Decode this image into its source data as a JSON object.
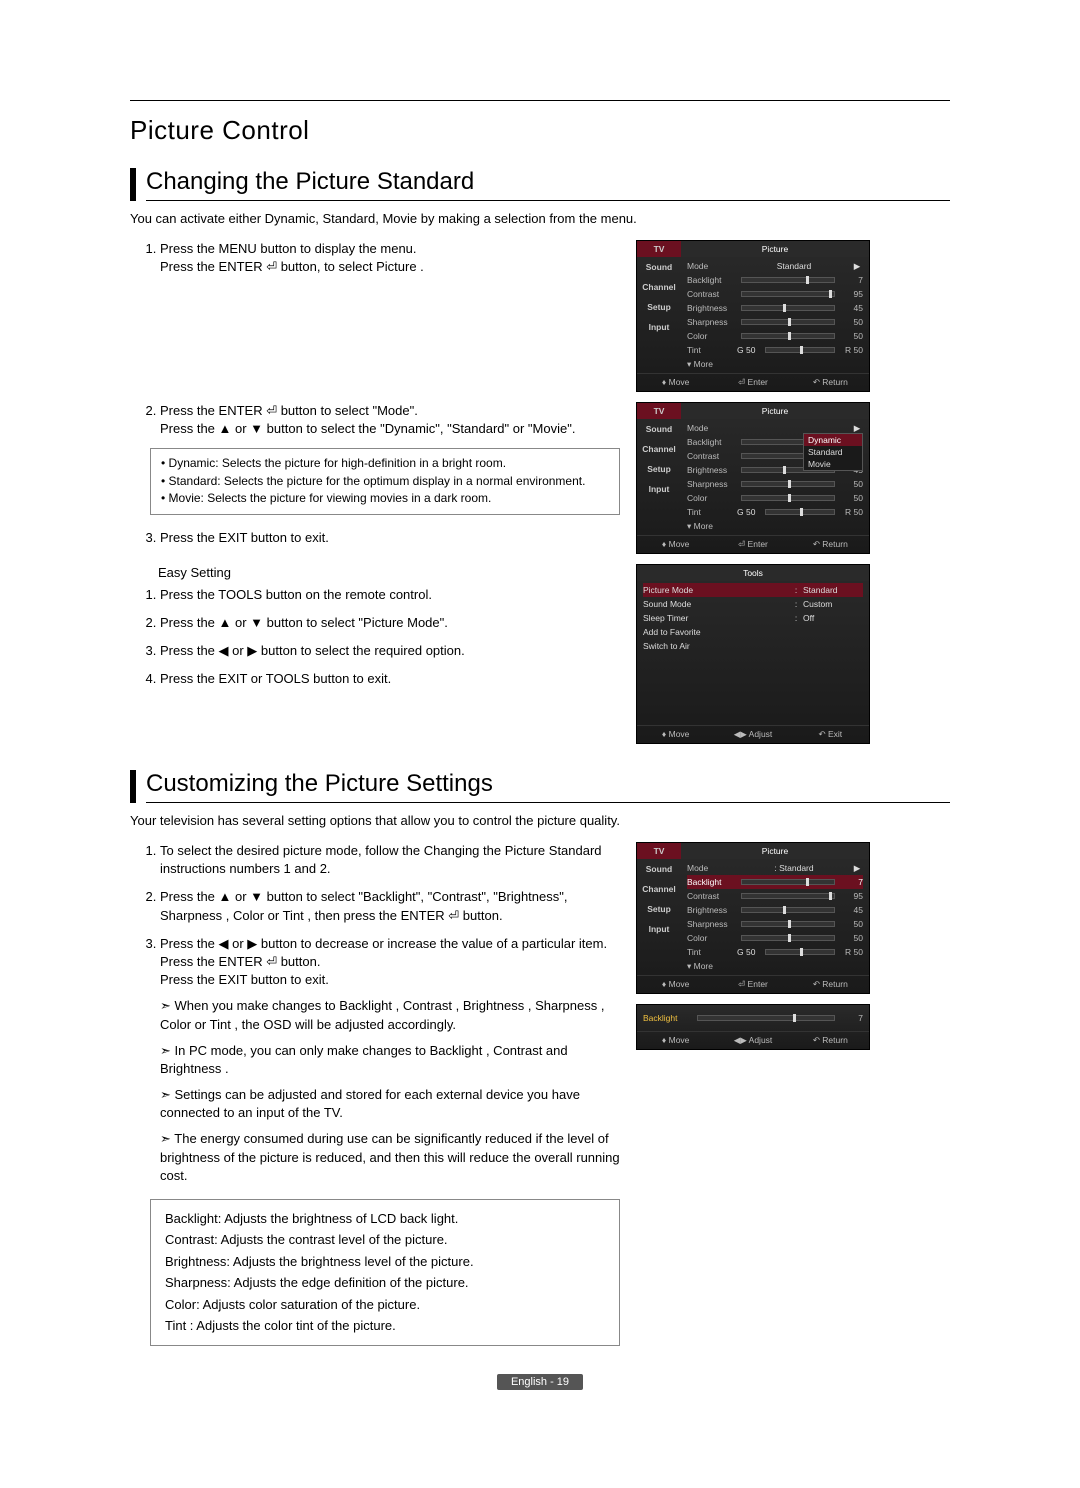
{
  "doc": {
    "section": "Picture Control",
    "sub1": {
      "title": "Changing the Picture Standard",
      "intro": "You can activate either Dynamic, Standard, Movie by making a selection from the menu.",
      "step1": "Press the MENU button to display the menu.\nPress the ENTER ⏎ button, to select Picture .",
      "step2": "Press the ENTER ⏎ button to select \"Mode\".\nPress the ▲ or ▼ button to select the \"Dynamic\", \"Standard\" or \"Movie\".",
      "desc_dynamic": "Dynamic: Selects the picture for high-definition in a bright room.",
      "desc_standard": "Standard: Selects the picture for the optimum display in a normal environment.",
      "desc_movie": "Movie: Selects the picture for viewing movies in a dark room.",
      "step3": "Press the EXIT button to exit.",
      "easy_title": "Easy Setting",
      "easy1": "Press the TOOLS button on the remote control.",
      "easy2": "Press the ▲ or ▼ button to select \"Picture Mode\".",
      "easy3": "Press the ◀ or ▶ button to select the required option.",
      "easy4": "Press the EXIT or TOOLS button to exit."
    },
    "sub2": {
      "title": "Customizing the Picture Settings",
      "intro": "Your television has several setting options that allow you to control the picture quality.",
      "step1": "To select the desired picture mode, follow the Changing the Picture Standard instructions numbers 1 and 2.",
      "step2": "Press the ▲ or ▼ button to select \"Backlight\", \"Contrast\", \"Brightness\", Sharpness , Color or Tint , then press the ENTER ⏎ button.",
      "step3a": "Press the ◀ or ▶ button to decrease or increase the value of a particular item. Press the ENTER ⏎ button.",
      "step3b": "Press the EXIT button to exit.",
      "note1": "When you make changes to Backlight , Contrast , Brightness , Sharpness , Color or Tint , the OSD will be adjusted accordingly.",
      "note2": "In PC mode, you can only make changes to Backlight , Contrast and Brightness .",
      "note3": "Settings can be adjusted and stored for each external device you have connected to an input of the TV.",
      "note4": "The energy consumed during use can be significantly reduced if the level of brightness of the picture is reduced, and then this will reduce the overall running cost.",
      "gloss_backlight": "Backlight: Adjusts the brightness of LCD back light.",
      "gloss_contrast": "Contrast: Adjusts the contrast level of the picture.",
      "gloss_brightness": "Brightness: Adjusts the brightness level of the picture.",
      "gloss_sharpness": "Sharpness: Adjusts the edge definition of the picture.",
      "gloss_color": "Color: Adjusts color saturation of the picture.",
      "gloss_tint": "Tint : Adjusts the color tint of the picture."
    },
    "pager": "English - 19"
  },
  "osd": {
    "tabs": {
      "tv": "TV",
      "sound": "Sound",
      "channel": "Channel",
      "setup": "Setup",
      "input": "Input"
    },
    "picture_title": "Picture",
    "tools_title": "Tools",
    "foot": {
      "move": "♦ Move",
      "enter": "⏎ Enter",
      "return": "↶ Return",
      "adjust": "◀▶ Adjust",
      "exit": "↶ Exit"
    },
    "labels": {
      "mode": "Mode",
      "backlight": "Backlight",
      "contrast": "Contrast",
      "brightness": "Brightness",
      "sharpness": "Sharpness",
      "color": "Color",
      "tint": "Tint",
      "more": "▾ More"
    },
    "values": {
      "mode_standard": "Standard",
      "backlight": "7",
      "contrast": "95",
      "brightness": "45",
      "sharpness": "50",
      "color": "50",
      "tint_left": "G 50",
      "tint_right": "R 50"
    },
    "dropdown": {
      "dynamic": "Dynamic",
      "standard": "Standard",
      "movie": "Movie"
    },
    "tools": {
      "picture_mode_l": "Picture Mode",
      "picture_mode_r": "Standard",
      "sound_l": "Sound Mode",
      "sound_r": "Custom",
      "sleep_l": "Sleep Timer",
      "sleep_r": "Off",
      "fav": "Add to Favorite",
      "air": "Switch to Air"
    },
    "small_label": "Backlight",
    "small_value": "7"
  }
}
